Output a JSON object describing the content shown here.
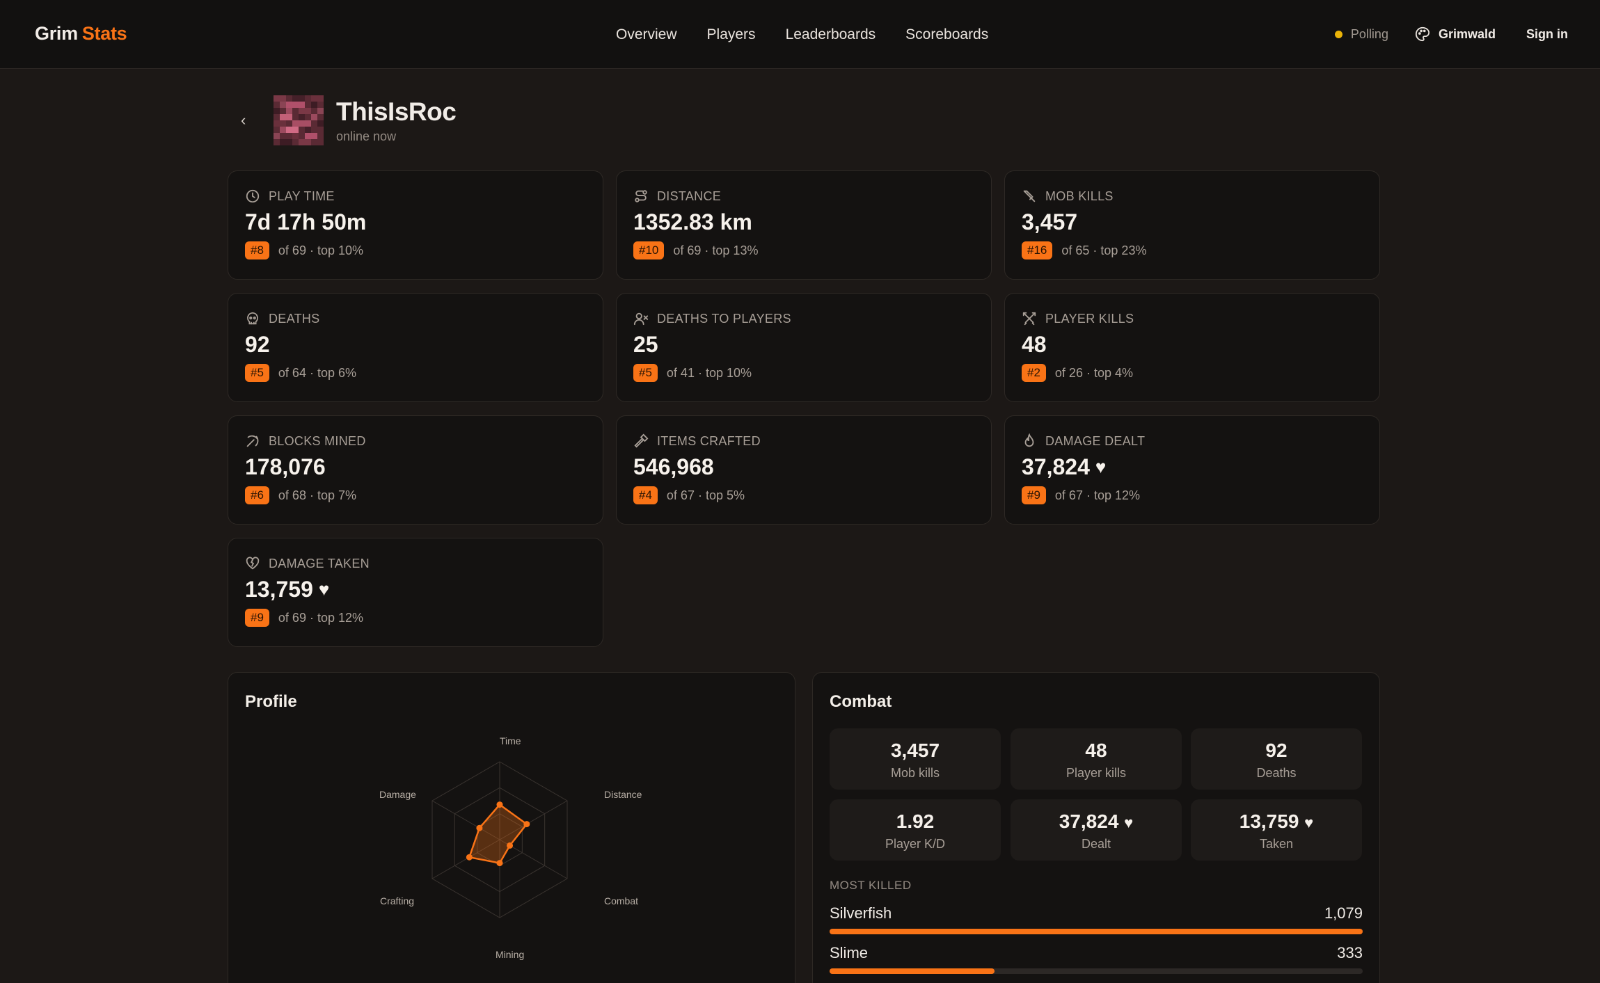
{
  "header": {
    "brand_a": "Grim",
    "brand_b": "Stats",
    "nav": [
      "Overview",
      "Players",
      "Leaderboards",
      "Scoreboards"
    ],
    "status": "Polling",
    "server": "Grimwald",
    "signin": "Sign in"
  },
  "player": {
    "name": "ThisIsRoc",
    "status": "online now",
    "back_glyph": "‹"
  },
  "stats": [
    {
      "icon": "clock-icon",
      "label": "PLAY TIME",
      "value": "7d 17h 50m",
      "rank": "#8",
      "rank_text": "of 69 · top 10%"
    },
    {
      "icon": "route-icon",
      "label": "DISTANCE",
      "value": "1352.83 km",
      "rank": "#10",
      "rank_text": "of 69 · top 13%"
    },
    {
      "icon": "sword-icon",
      "label": "MOB KILLS",
      "value": "3,457",
      "rank": "#16",
      "rank_text": "of 65 · top 23%"
    },
    {
      "icon": "skull-icon",
      "label": "DEATHS",
      "value": "92",
      "rank": "#5",
      "rank_text": "of 64 · top 6%"
    },
    {
      "icon": "user-x-icon",
      "label": "DEATHS TO PLAYERS",
      "value": "25",
      "rank": "#5",
      "rank_text": "of 41 · top 10%"
    },
    {
      "icon": "crossed-swords-icon",
      "label": "PLAYER KILLS",
      "value": "48",
      "rank": "#2",
      "rank_text": "of 26 · top 4%"
    },
    {
      "icon": "pickaxe-icon",
      "label": "BLOCKS MINED",
      "value": "178,076",
      "rank": "#6",
      "rank_text": "of 68 · top 7%"
    },
    {
      "icon": "hammer-icon",
      "label": "ITEMS CRAFTED",
      "value": "546,968",
      "rank": "#4",
      "rank_text": "of 67 · top 5%"
    },
    {
      "icon": "flame-icon",
      "label": "DAMAGE DEALT",
      "value": "37,824",
      "heart": "♥",
      "rank": "#9",
      "rank_text": "of 67 · top 12%"
    },
    {
      "icon": "heart-crack-icon",
      "label": "DAMAGE TAKEN",
      "value": "13,759",
      "heart": "♥",
      "rank": "#9",
      "rank_text": "of 69 · top 12%"
    }
  ],
  "profile": {
    "title": "Profile",
    "axes": [
      "Time",
      "Distance",
      "Combat",
      "Mining",
      "Crafting",
      "Damage"
    ],
    "values": [
      0.45,
      0.4,
      0.15,
      0.3,
      0.45,
      0.3
    ],
    "accent": "#f97316"
  },
  "combat": {
    "title": "Combat",
    "tiles": [
      {
        "value": "3,457",
        "label": "Mob kills"
      },
      {
        "value": "48",
        "label": "Player kills"
      },
      {
        "value": "92",
        "label": "Deaths"
      },
      {
        "value": "1.92",
        "label": "Player K/D"
      },
      {
        "value": "37,824",
        "heart": "♥",
        "label": "Dealt"
      },
      {
        "value": "13,759",
        "heart": "♥",
        "label": "Taken"
      }
    ],
    "most_killed_title": "MOST KILLED",
    "most_killed": [
      {
        "name": "Silverfish",
        "count": "1,079",
        "fraction": 1.0
      },
      {
        "name": "Slime",
        "count": "333",
        "fraction": 0.31
      }
    ]
  }
}
